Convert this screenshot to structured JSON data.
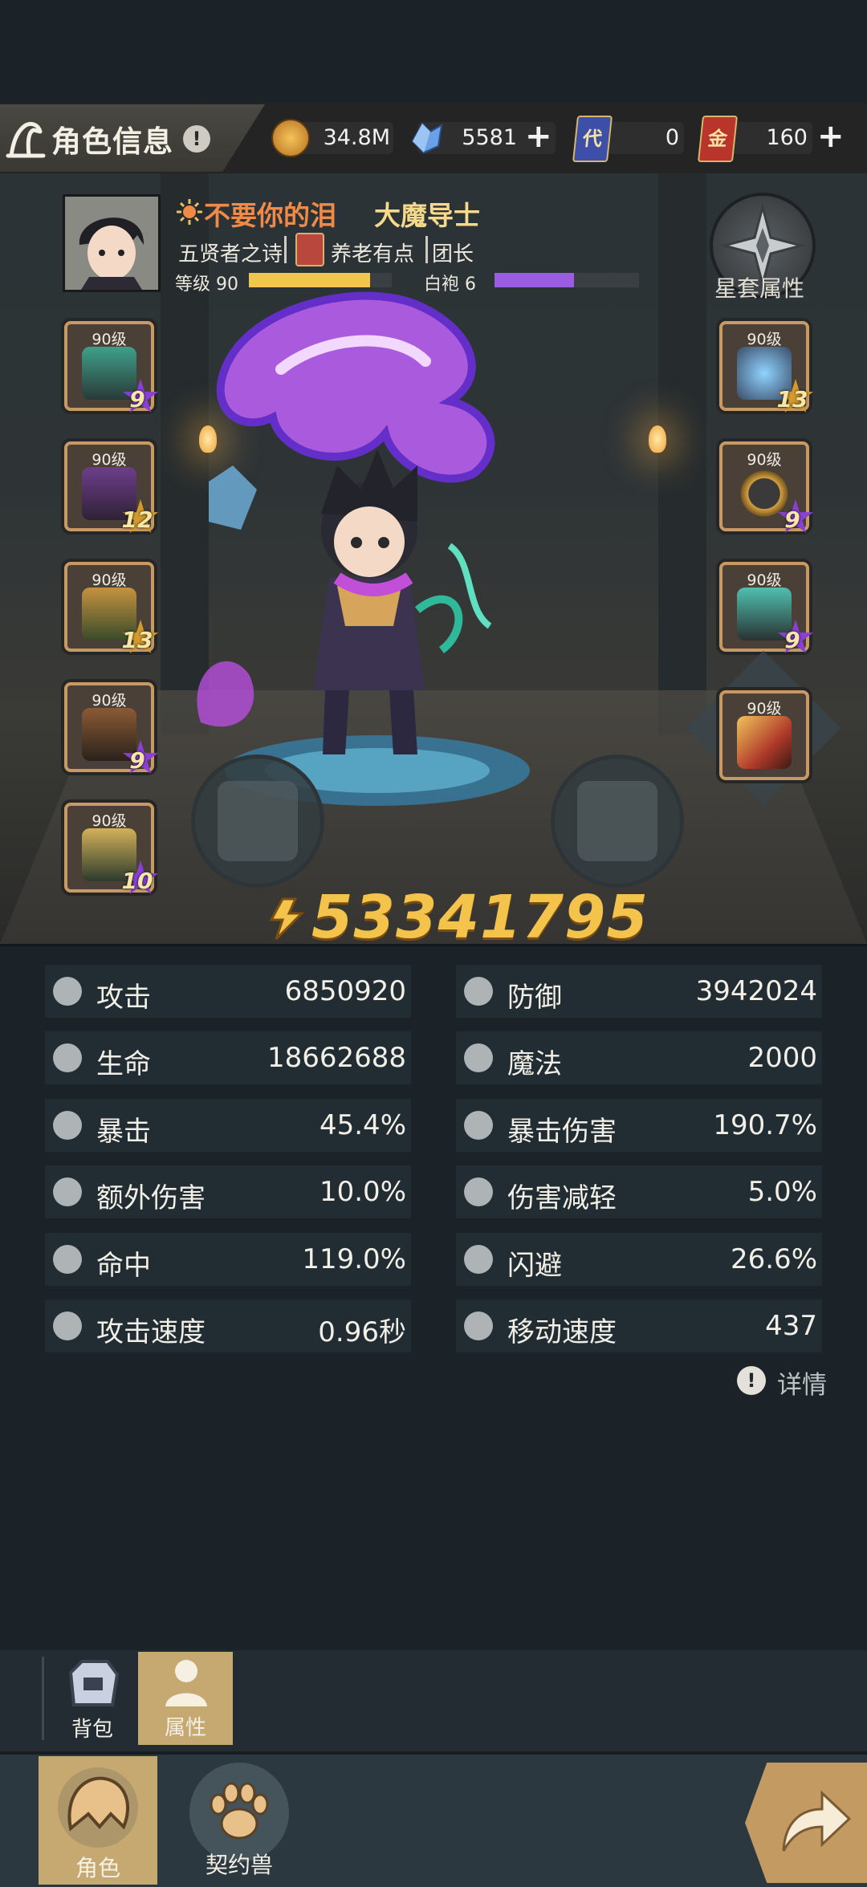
{
  "header": {
    "title": "角色信息",
    "info_icon": "!",
    "currencies": [
      {
        "name": "gold",
        "value": "34.8M",
        "has_plus": false
      },
      {
        "name": "crystal",
        "value": "5581",
        "has_plus": true
      },
      {
        "name": "card-dai",
        "icon_char": "代",
        "value": "0",
        "has_plus": false
      },
      {
        "name": "card-jin",
        "icon_char": "金",
        "value": "160",
        "has_plus": true
      }
    ],
    "plus_symbol": "+"
  },
  "character": {
    "name": "不要你的泪",
    "class": "大魔导士",
    "guild": "五贤者之诗",
    "guild_tag": "养老有点",
    "role": "团长",
    "level_label": "等级 90",
    "level_progress": 0.85,
    "robe_label": "白袍 6",
    "robe_progress": 0.55,
    "set_attr_label": "星套属性",
    "combat_power": "53341795"
  },
  "equipment": {
    "left": [
      {
        "level": "90级",
        "stars": "9",
        "star_color": "#8a3fd6"
      },
      {
        "level": "90级",
        "stars": "12",
        "star_color": "#d49a2c"
      },
      {
        "level": "90级",
        "stars": "13",
        "star_color": "#d49a2c"
      },
      {
        "level": "90级",
        "stars": "9",
        "star_color": "#8a3fd6"
      },
      {
        "level": "90级",
        "stars": "10",
        "star_color": "#8a3fd6"
      }
    ],
    "right": [
      {
        "level": "90级",
        "stars": "13",
        "star_color": "#d49a2c"
      },
      {
        "level": "90级",
        "stars": "9",
        "star_color": "#8a3fd6"
      },
      {
        "level": "90级",
        "stars": "9",
        "star_color": "#8a3fd6"
      },
      {
        "level": "90级",
        "stars": "",
        "star_color": ""
      }
    ]
  },
  "stats": [
    {
      "name": "攻击",
      "value": "6850920",
      "icon": "sword-icon"
    },
    {
      "name": "防御",
      "value": "3942024",
      "icon": "shield-icon"
    },
    {
      "name": "生命",
      "value": "18662688",
      "icon": "heart-icon"
    },
    {
      "name": "魔法",
      "value": "2000",
      "icon": "magic-icon"
    },
    {
      "name": "暴击",
      "value": "45.4%",
      "icon": "crit-icon"
    },
    {
      "name": "暴击伤害",
      "value": "190.7%",
      "icon": "crit-damage-icon"
    },
    {
      "name": "额外伤害",
      "value": "10.0%",
      "icon": "extra-damage-icon"
    },
    {
      "name": "伤害减轻",
      "value": "5.0%",
      "icon": "damage-reduction-icon"
    },
    {
      "name": "命中",
      "value": "119.0%",
      "icon": "accuracy-icon"
    },
    {
      "name": "闪避",
      "value": "26.6%",
      "icon": "dodge-icon"
    },
    {
      "name": "攻击速度",
      "value": "0.96秒",
      "icon": "attack-speed-icon"
    },
    {
      "name": "移动速度",
      "value": "437",
      "icon": "move-speed-icon"
    }
  ],
  "details_label": "详情",
  "subtabs": [
    {
      "label": "背包",
      "active": false
    },
    {
      "label": "属性",
      "active": true
    }
  ],
  "nav": [
    {
      "label": "角色",
      "active": true
    },
    {
      "label": "契约兽",
      "active": false
    }
  ],
  "colors": {
    "gold": "#f4c34b",
    "name_orange": "#f08a46",
    "class_yellow": "#f7d98a",
    "purple": "#9a5ce0",
    "panel": "#212c33"
  }
}
